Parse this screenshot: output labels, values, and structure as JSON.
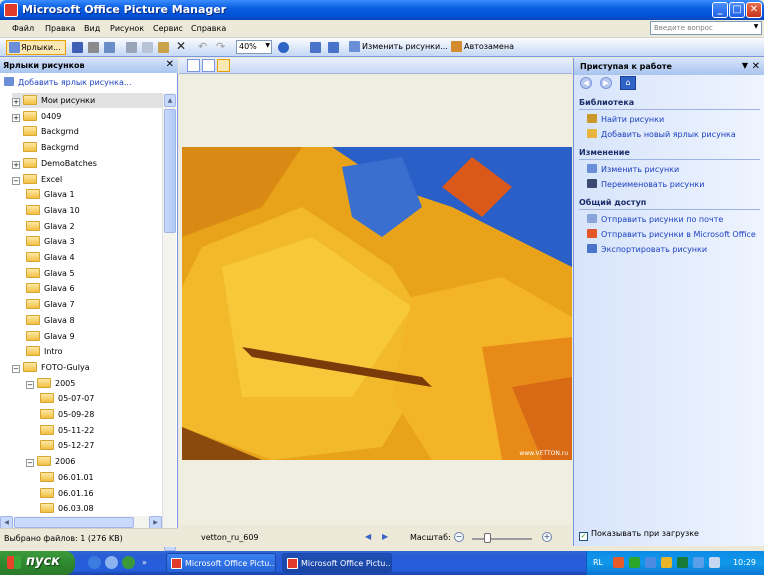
{
  "window": {
    "title": "Microsoft Office Picture Manager",
    "minimize": "_",
    "maximize": "□",
    "close": "✕"
  },
  "menu": {
    "items": [
      "Файл",
      "Правка",
      "Вид",
      "Рисунок",
      "Сервис",
      "Справка"
    ],
    "help_placeholder": "Введите вопрос"
  },
  "toolbar": {
    "shortcuts_label": "Ярлыки...",
    "zoom_value": "40%",
    "edit_pictures_label": "Изменить рисунки...",
    "autocorrect_label": "Автозамена"
  },
  "left_panel": {
    "title": "Ярлыки рисунков",
    "add_shortcut": "Добавить ярлык рисунка...",
    "tree": [
      {
        "label": "Мои рисунки",
        "level": 0,
        "toggle": "+",
        "selected": true
      },
      {
        "label": "0409",
        "level": 0,
        "toggle": "+"
      },
      {
        "label": "Backgrnd",
        "level": 0,
        "toggle": ""
      },
      {
        "label": "Backgrnd",
        "level": 0,
        "toggle": ""
      },
      {
        "label": "DemoBatches",
        "level": 0,
        "toggle": "+"
      },
      {
        "label": "Excel",
        "level": 0,
        "toggle": "−"
      },
      {
        "label": "Glava 1",
        "level": 1,
        "toggle": ""
      },
      {
        "label": "Glava 10",
        "level": 1,
        "toggle": ""
      },
      {
        "label": "Glava 2",
        "level": 1,
        "toggle": ""
      },
      {
        "label": "Glava 3",
        "level": 1,
        "toggle": ""
      },
      {
        "label": "Glava 4",
        "level": 1,
        "toggle": ""
      },
      {
        "label": "Glava 5",
        "level": 1,
        "toggle": ""
      },
      {
        "label": "Glava 6",
        "level": 1,
        "toggle": ""
      },
      {
        "label": "Glava 7",
        "level": 1,
        "toggle": ""
      },
      {
        "label": "Glava 8",
        "level": 1,
        "toggle": ""
      },
      {
        "label": "Glava 9",
        "level": 1,
        "toggle": ""
      },
      {
        "label": "Intro",
        "level": 1,
        "toggle": ""
      },
      {
        "label": "FOTO-Gulya",
        "level": 0,
        "toggle": "−"
      },
      {
        "label": "2005",
        "level": 1,
        "toggle": "−"
      },
      {
        "label": "05-07-07",
        "level": 2,
        "toggle": ""
      },
      {
        "label": "05-09-28",
        "level": 2,
        "toggle": ""
      },
      {
        "label": "05-11-22",
        "level": 2,
        "toggle": ""
      },
      {
        "label": "05-12-27",
        "level": 2,
        "toggle": ""
      },
      {
        "label": "2006",
        "level": 1,
        "toggle": "−"
      },
      {
        "label": "06.01.01",
        "level": 2,
        "toggle": ""
      },
      {
        "label": "06.01.16",
        "level": 2,
        "toggle": ""
      },
      {
        "label": "06.03.08",
        "level": 2,
        "toggle": ""
      }
    ],
    "status": "Выбрано файлов: 1 (276 KB)"
  },
  "center": {
    "watermark": "www.VETTON.ru",
    "file_name": "vetton_ru_609",
    "zoom_label": "Масштаб:"
  },
  "right_panel": {
    "title": "Приступая к работе",
    "sections": [
      {
        "title": "Библиотека",
        "links": [
          "Найти рисунки",
          "Добавить новый ярлык рисунка"
        ]
      },
      {
        "title": "Изменение",
        "links": [
          "Изменить рисунки",
          "Переименовать рисунки"
        ]
      },
      {
        "title": "Общий доступ",
        "links": [
          "Отправить рисунки по почте",
          "Отправить рисунки в Microsoft Office",
          "Экспортировать рисунки"
        ]
      }
    ],
    "show_on_startup": "Показывать при загрузке"
  },
  "taskbar": {
    "start_label": "пуск",
    "tasks": [
      "Microsoft Office Pictu...",
      "Microsoft Office Pictu..."
    ],
    "language": "RL",
    "clock": "10:29"
  },
  "colors": {
    "title_blue": "#0a5fe0",
    "link_blue": "#1a3fbf",
    "start_green": "#3c9a3c",
    "tray_blue": "#0c8be8"
  }
}
